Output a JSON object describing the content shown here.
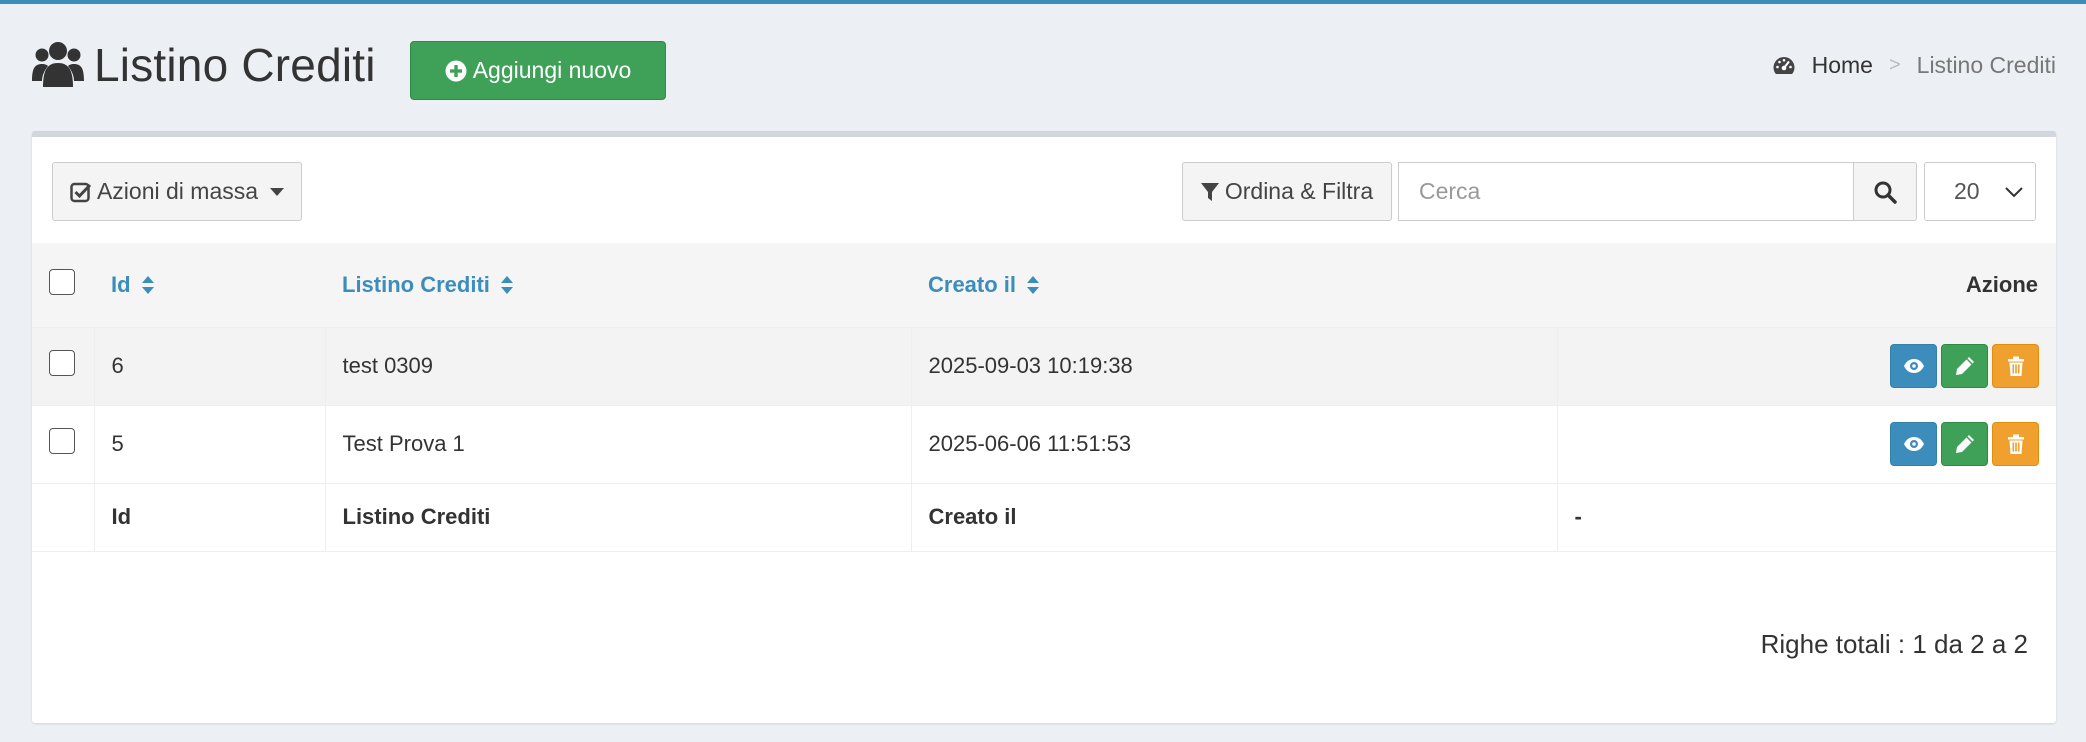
{
  "header": {
    "title": "Listino Crediti",
    "add_button_label": "Aggiungi nuovo",
    "breadcrumb": {
      "home": "Home",
      "separator": ">",
      "current": "Listino Crediti"
    }
  },
  "toolbar": {
    "bulk_actions_label": "Azioni di massa",
    "filter_label": "Ordina & Filtra",
    "search_placeholder": "Cerca",
    "per_page": "20"
  },
  "table": {
    "columns": {
      "id": "Id",
      "listino": "Listino Crediti",
      "creato": "Creato il",
      "azione": "Azione"
    },
    "rows": [
      {
        "id": "6",
        "listino": "test 0309",
        "creato": "2025-09-03 10:19:38"
      },
      {
        "id": "5",
        "listino": "Test Prova 1",
        "creato": "2025-06-06 11:51:53"
      }
    ],
    "footer": {
      "id": "Id",
      "listino": "Listino Crediti",
      "creato": "Creato il",
      "azione": "-"
    }
  },
  "total_rows_label": "Righe totali : 1 da 2 a 2",
  "colors": {
    "accent": "#3c8dbc",
    "success": "#3fa157",
    "warning": "#f0a02f",
    "background": "#ecf0f5"
  },
  "icons": [
    "users-icon",
    "plus-circle-icon",
    "dashboard-icon",
    "check-square-icon",
    "caret-down-icon",
    "filter-icon",
    "search-icon",
    "chevron-down-icon",
    "sort-icon",
    "eye-icon",
    "pencil-icon",
    "trash-icon"
  ]
}
